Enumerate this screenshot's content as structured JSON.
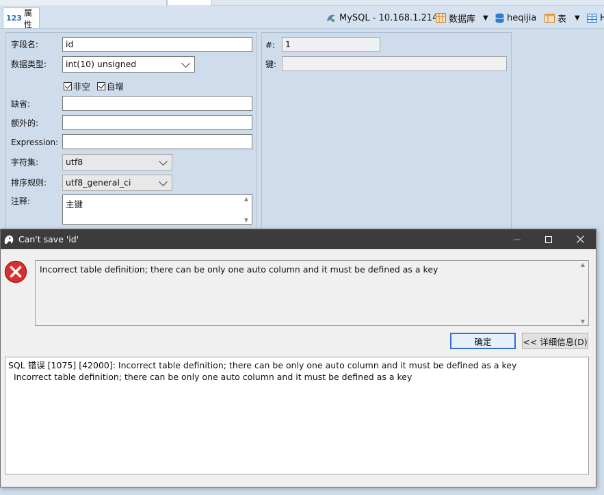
{
  "toolbar": {
    "properties_tab": {
      "number_glyph": "123",
      "label": "属性"
    },
    "connection": "MySQL - 10.168.1.214",
    "database_label": "数据库",
    "schema": "heqijia",
    "table_label": "表",
    "extra_label": "H"
  },
  "left_form": {
    "field_name": {
      "label": "字段名:",
      "value": "id"
    },
    "data_type": {
      "label": "数据类型:",
      "value": "int(10) unsigned"
    },
    "not_null": {
      "label": "非空",
      "checked": true
    },
    "auto_increment": {
      "label": "自增",
      "checked": true
    },
    "default": {
      "label": "缺省:",
      "value": ""
    },
    "extra": {
      "label": "额外的:",
      "value": ""
    },
    "expression": {
      "label": "Expression:",
      "value": ""
    },
    "charset": {
      "label": "字符集:",
      "value": "utf8"
    },
    "collation": {
      "label": "排序规则:",
      "value": "utf8_general_ci"
    },
    "comment": {
      "label": "注释:",
      "value": "主键"
    }
  },
  "right_form": {
    "ordinal": {
      "label": "#:",
      "value": "1"
    },
    "key": {
      "label": "键:",
      "value": ""
    }
  },
  "dialog": {
    "title": "Can't save 'id'",
    "message": "Incorrect table definition; there can be only one auto column and it must be defined as a key",
    "ok_label": "确定",
    "details_label": "<< 详细信息(D)",
    "details_line1": "SQL 错误 [1075] [42000]: Incorrect table definition; there can be only one auto column and it must be defined as a key",
    "details_line2": "  Incorrect table definition; there can be only one auto column and it must be defined as a key"
  },
  "colors": {
    "panel_bg": "#cfdceb",
    "dialog_title_bg": "#3c3c3c",
    "error_red": "#d9302f",
    "primary_border": "#2f6fd0"
  }
}
